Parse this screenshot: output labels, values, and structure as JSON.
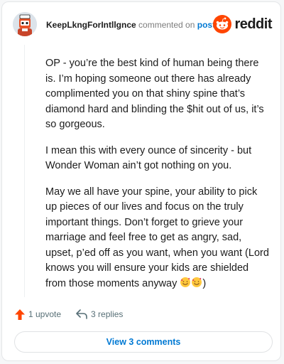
{
  "comment": {
    "username": "KeepLkngForIntllgnce",
    "action_text": "commented on",
    "post_link": "post",
    "paragraphs": [
      "OP - you’re the best kind of human being there is. I’m hoping someone out there has already complimented you on that shiny spine that’s diamond hard and blinding the $hit out of us, it’s so gorgeous.",
      "I mean this with every ounce of sincerity - but Wonder Woman ain’t got nothing on you.",
      "May we all have your spine, your ability to pick up pieces of our lives and focus on the truly important things. Don’t forget to grieve your marriage and feel free to get as angry, sad, upset, p’ed off as you want, when you want (Lord knows you will ensure your kids are shielded from those moments anyway"
    ],
    "paragraph_end": ")",
    "upvotes": "1 upvote",
    "replies": "3 replies",
    "view_comments": "View 3 comments"
  },
  "brand": {
    "name": "reddit",
    "color": "#ff4500"
  },
  "colors": {
    "link": "#0079d3",
    "upvote": "#ff4500",
    "muted": "#576f76"
  },
  "icons": [
    "avatar",
    "reddit-logo-icon",
    "upvote-icon",
    "reply-icon",
    "smiling-face-with-hearts-icon"
  ]
}
